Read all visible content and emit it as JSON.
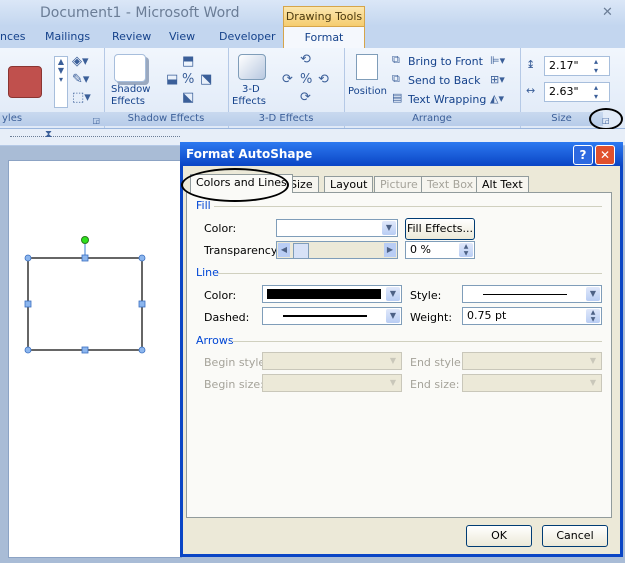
{
  "window": {
    "title": "Document1 - Microsoft Word",
    "context_tab": "Drawing Tools"
  },
  "ribbon_tabs": [
    "nces",
    "Mailings",
    "Review",
    "View",
    "Developer",
    "Format"
  ],
  "ribbon": {
    "groups": {
      "styles": "yles",
      "shadow_effects": "Shadow Effects",
      "threed_effects": "3-D Effects",
      "arrange": "Arrange",
      "size": "Size"
    },
    "buttons": {
      "shadow_effects_1": "Shadow",
      "shadow_effects_2": "Effects",
      "threed_1": "3-D",
      "threed_2": "Effects",
      "position": "Position",
      "bring_to_front": "Bring to Front",
      "send_to_back": "Send to Back",
      "text_wrapping": "Text Wrapping"
    },
    "size": {
      "height": "2.17\"",
      "width": "2.63\""
    },
    "accent_color": "#c0504d"
  },
  "dialog": {
    "title": "Format AutoShape",
    "help": "?",
    "close": "✕",
    "tabs": [
      "Colors and Lines",
      "Size",
      "Layout",
      "Picture",
      "Text Box",
      "Alt Text"
    ],
    "fill": {
      "section": "Fill",
      "color_label": "Color:",
      "fill_effects": "Fill Effects...",
      "transparency_label": "Transparency:",
      "transparency_value": "0 %"
    },
    "line": {
      "section": "Line",
      "color_label": "Color:",
      "style_label": "Style:",
      "dashed_label": "Dashed:",
      "weight_label": "Weight:",
      "weight_value": "0.75 pt"
    },
    "arrows": {
      "section": "Arrows",
      "begin_style": "Begin style:",
      "end_style": "End style:",
      "begin_size": "Begin size:",
      "end_size": "End size:"
    },
    "ok": "OK",
    "cancel": "Cancel"
  }
}
